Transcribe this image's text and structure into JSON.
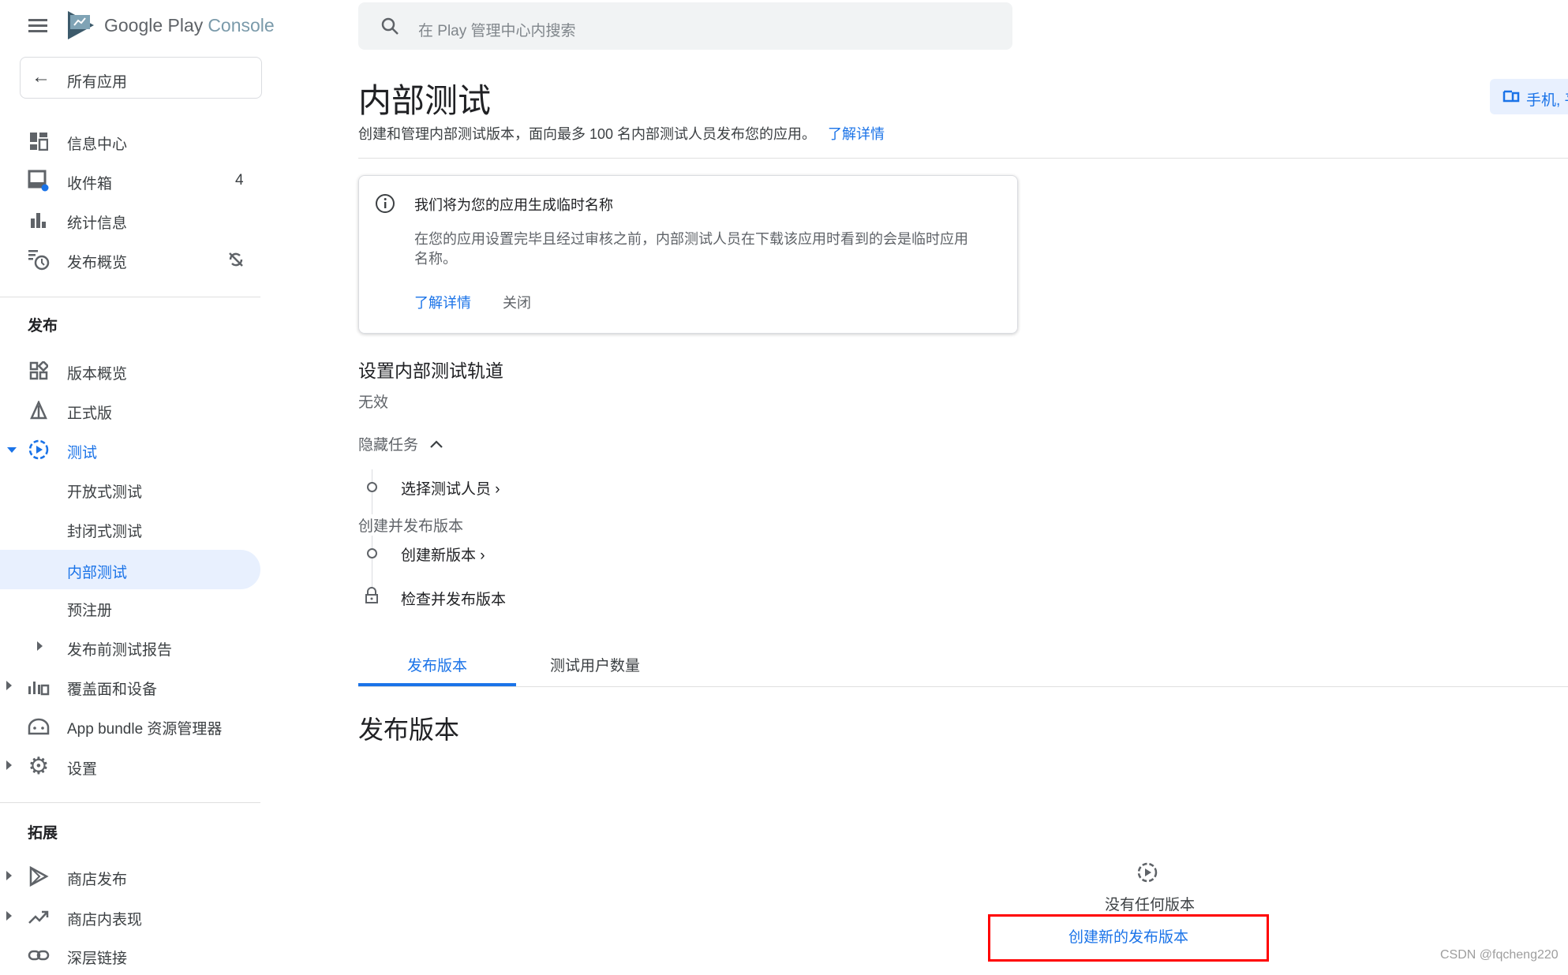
{
  "header": {
    "logo_text": "Google Play",
    "logo_console": "Console",
    "search_placeholder": "在 Play 管理中心内搜索"
  },
  "sidebar": {
    "all_apps": "所有应用",
    "top_items": [
      {
        "label": "信息中心"
      },
      {
        "label": "收件箱",
        "badge": "4"
      },
      {
        "label": "统计信息"
      },
      {
        "label": "发布概览"
      }
    ],
    "section_release": "发布",
    "release_items": [
      {
        "label": "版本概览"
      },
      {
        "label": "正式版"
      },
      {
        "label": "测试"
      },
      {
        "label": "开放式测试"
      },
      {
        "label": "封闭式测试"
      },
      {
        "label": "内部测试"
      },
      {
        "label": "预注册"
      },
      {
        "label": "发布前测试报告"
      },
      {
        "label": "覆盖面和设备"
      },
      {
        "label": "App bundle 资源管理器"
      },
      {
        "label": "设置"
      }
    ],
    "section_grow": "拓展",
    "grow_items": [
      {
        "label": "商店发布"
      },
      {
        "label": "商店内表现"
      },
      {
        "label": "深层链接"
      }
    ]
  },
  "main": {
    "title": "内部测试",
    "subtitle": "创建和管理内部测试版本，面向最多 100 名内部测试人员发布您的应用。",
    "subtitle_link": "了解详情",
    "device_chip": "手机, 平",
    "notice": {
      "title": "我们将为您的应用生成临时名称",
      "body": "在您的应用设置完毕且经过审核之前，内部测试人员在下载该应用时看到的会是临时应用名称。",
      "learn_more": "了解详情",
      "close": "关闭"
    },
    "setup": {
      "title": "设置内部测试轨道",
      "status": "无效",
      "toggle": "隐藏任务",
      "task1": "选择测试人员",
      "group": "创建并发布版本",
      "task2": "创建新版本",
      "task3": "检查并发布版本"
    },
    "tabs": [
      {
        "label": "发布版本"
      },
      {
        "label": "测试用户数量"
      }
    ],
    "section_title": "发布版本",
    "empty_text": "没有任何版本",
    "create_button": "创建新的发布版本"
  },
  "watermark": "CSDN @fqcheng220",
  "colors": {
    "accent": "#1a73e8",
    "selected_bg": "#e8f0fe",
    "highlight_box": "#ff0000"
  }
}
